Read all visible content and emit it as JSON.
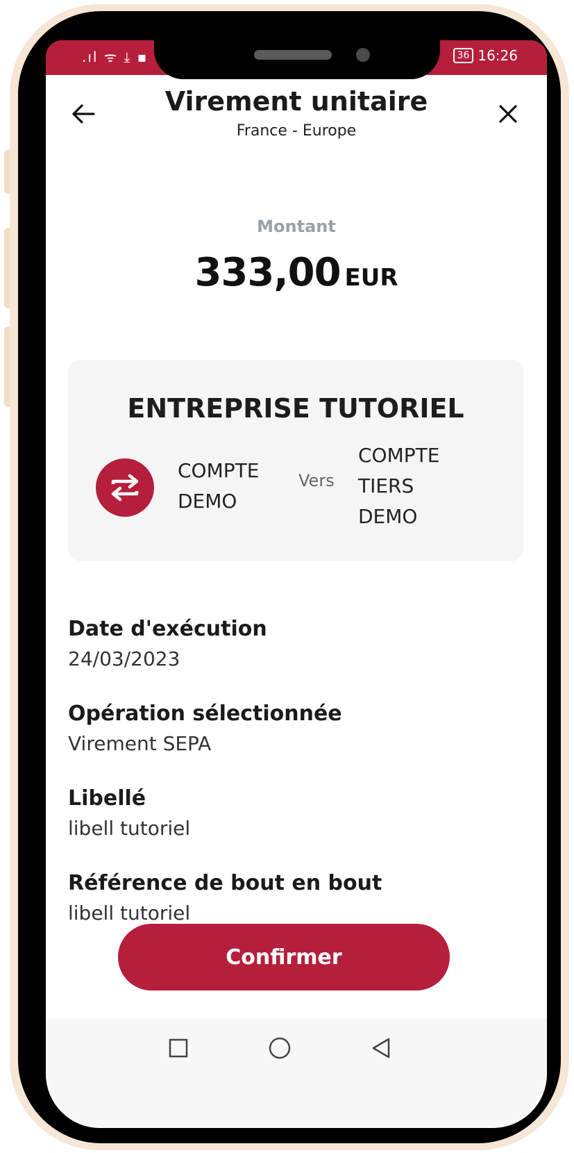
{
  "status_bar": {
    "left_icons": ".ıl ᯤ ⤓ ▪",
    "battery": "36",
    "time": "16:26"
  },
  "header": {
    "title": "Virement unitaire",
    "subtitle": "France - Europe"
  },
  "amount": {
    "label": "Montant",
    "value": "333,00",
    "currency": "EUR"
  },
  "transfer": {
    "company": "ENTREPRISE TUTORIEL",
    "from_line1": "COMPTE",
    "from_line2": "DEMO",
    "separator": "Vers",
    "to_line1": "COMPTE",
    "to_line2": "TIERS",
    "to_line3": "DEMO"
  },
  "details": [
    {
      "label": "Date d'exécution",
      "value": "24/03/2023"
    },
    {
      "label": "Opération sélectionnée",
      "value": "Virement SEPA"
    },
    {
      "label": "Libellé",
      "value": "libell tutoriel"
    },
    {
      "label": "Référence de bout en bout",
      "value": "libell tutoriel"
    }
  ],
  "actions": {
    "confirm_label": "Confirmer"
  },
  "colors": {
    "brand": "#b51f3b",
    "card_background": "#f5f5f5",
    "frame": "#000000",
    "frame_rim": "#f6e6d5"
  },
  "icons": {
    "back": "arrow-left-icon",
    "close": "close-icon",
    "swap": "swap-arrows-icon",
    "nav_recent": "square-icon",
    "nav_home": "circle-icon",
    "nav_back": "triangle-back-icon"
  }
}
